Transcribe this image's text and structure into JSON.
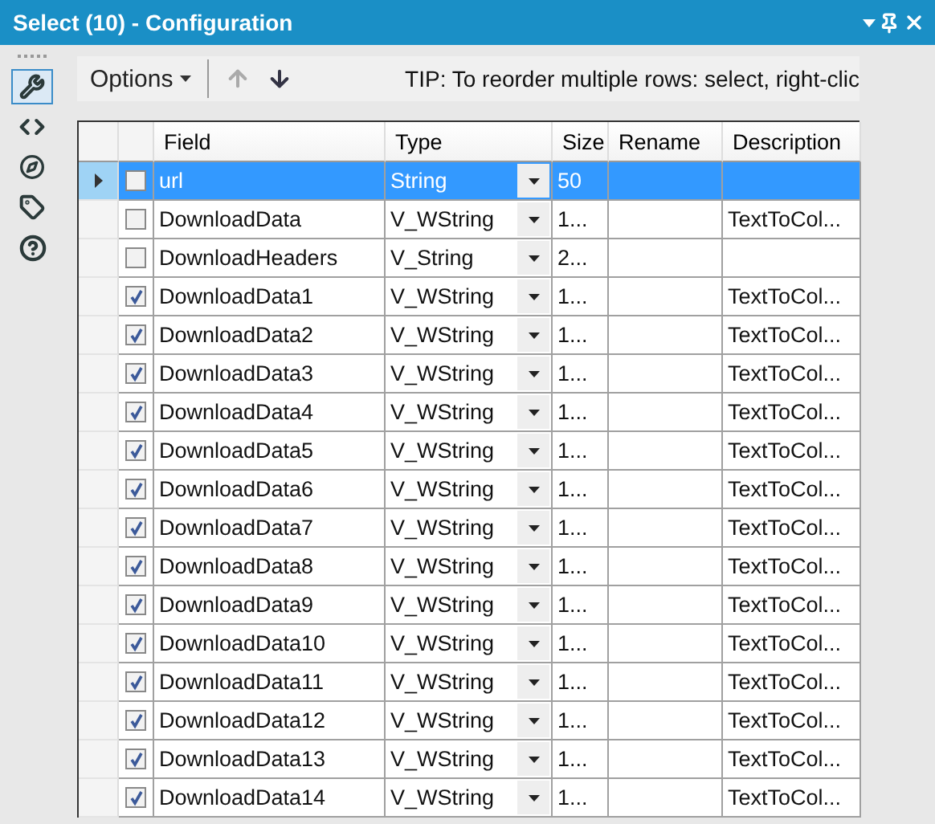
{
  "window": {
    "title": "Select (10) - Configuration"
  },
  "sidebar": {
    "items": [
      {
        "kind": "wrench",
        "selected": true
      },
      {
        "kind": "code",
        "selected": false
      },
      {
        "kind": "compass",
        "selected": false
      },
      {
        "kind": "tag",
        "selected": false
      },
      {
        "kind": "help",
        "selected": false
      }
    ]
  },
  "toolbar": {
    "options_label": "Options",
    "tip": "TIP: To reorder multiple rows: select, right-clic"
  },
  "table": {
    "columns": [
      "Field",
      "Type",
      "Size",
      "Rename",
      "Description"
    ],
    "rows": [
      {
        "field": "url",
        "type": "String",
        "size": "50",
        "checked": false,
        "selected": true
      },
      {
        "field": "DownloadData",
        "type": "V_WString",
        "size": "1...",
        "description": "TextToCol...",
        "checked": false,
        "selected": false
      },
      {
        "field": "DownloadHeaders",
        "type": "V_String",
        "size": "2...",
        "checked": false,
        "selected": false
      },
      {
        "field": "DownloadData1",
        "type": "V_WString",
        "size": "1...",
        "description": "TextToCol...",
        "checked": true,
        "selected": false
      },
      {
        "field": "DownloadData2",
        "type": "V_WString",
        "size": "1...",
        "description": "TextToCol...",
        "checked": true,
        "selected": false
      },
      {
        "field": "DownloadData3",
        "type": "V_WString",
        "size": "1...",
        "description": "TextToCol...",
        "checked": true,
        "selected": false
      },
      {
        "field": "DownloadData4",
        "type": "V_WString",
        "size": "1...",
        "description": "TextToCol...",
        "checked": true,
        "selected": false
      },
      {
        "field": "DownloadData5",
        "type": "V_WString",
        "size": "1...",
        "description": "TextToCol...",
        "checked": true,
        "selected": false
      },
      {
        "field": "DownloadData6",
        "type": "V_WString",
        "size": "1...",
        "description": "TextToCol...",
        "checked": true,
        "selected": false
      },
      {
        "field": "DownloadData7",
        "type": "V_WString",
        "size": "1...",
        "description": "TextToCol...",
        "checked": true,
        "selected": false
      },
      {
        "field": "DownloadData8",
        "type": "V_WString",
        "size": "1...",
        "description": "TextToCol...",
        "checked": true,
        "selected": false
      },
      {
        "field": "DownloadData9",
        "type": "V_WString",
        "size": "1...",
        "description": "TextToCol...",
        "checked": true,
        "selected": false
      },
      {
        "field": "DownloadData10",
        "type": "V_WString",
        "size": "1...",
        "description": "TextToCol...",
        "checked": true,
        "selected": false
      },
      {
        "field": "DownloadData11",
        "type": "V_WString",
        "size": "1...",
        "description": "TextToCol...",
        "checked": true,
        "selected": false
      },
      {
        "field": "DownloadData12",
        "type": "V_WString",
        "size": "1...",
        "description": "TextToCol...",
        "checked": true,
        "selected": false
      },
      {
        "field": "DownloadData13",
        "type": "V_WString",
        "size": "1...",
        "description": "TextToCol...",
        "checked": true,
        "selected": false
      },
      {
        "field": "DownloadData14",
        "type": "V_WString",
        "size": "1...",
        "description": "TextToCol...",
        "checked": true,
        "selected": false
      }
    ]
  }
}
